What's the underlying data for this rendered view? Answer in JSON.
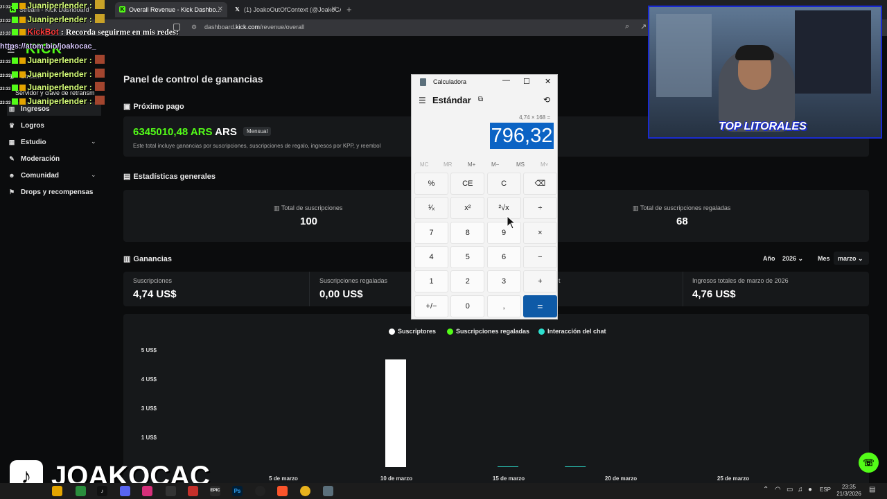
{
  "browser": {
    "tabs": [
      {
        "label": "Stream - Kick Dashboard",
        "active": false
      },
      {
        "label": "Overall Revenue - Kick Dashbo...",
        "active": true
      },
      {
        "label": "(1) JoakoOutOfContext (@JoakoCAC",
        "active": false
      }
    ],
    "url_prefix": "dashboard.",
    "url_domain": "kick.com",
    "url_path": "/revenue/overall"
  },
  "sidebar": {
    "logo": "KICK",
    "items": [
      {
        "label": "Stream",
        "icon": "stream-icon"
      },
      {
        "label": "Servidor y clave de retransm",
        "icon": "key-icon"
      },
      {
        "label": "Ingresos",
        "icon": "chart-icon",
        "active": true
      },
      {
        "label": "Logros",
        "icon": "trophy-icon"
      },
      {
        "label": "Estudio",
        "icon": "studio-icon",
        "expandable": true
      },
      {
        "label": "Moderación",
        "icon": "wrench-icon"
      },
      {
        "label": "Comunidad",
        "icon": "people-icon",
        "expandable": true
      },
      {
        "label": "Drops y recompensas",
        "icon": "gift-icon"
      }
    ]
  },
  "main": {
    "page_title": "Panel de control de ganancias",
    "next_payment": {
      "heading": "Próximo pago",
      "amount": "6345010,48 ARS",
      "currency": "ARS",
      "badge": "Mensual",
      "description": "Este total incluye ganancias por suscripciones, suscripciones de regalo, ingresos por KPP, y reembol"
    },
    "general_stats": {
      "heading": "Estadísticas generales",
      "items": [
        {
          "label": "Total de suscripciones",
          "value": "100"
        },
        {
          "label": "Total de suscripciones regaladas",
          "value": "68"
        }
      ]
    },
    "earnings": {
      "heading": "Ganancias",
      "year_label": "Año",
      "year_value": "2026",
      "month_label": "Mes",
      "month_value": "marzo",
      "items": [
        {
          "label": "Suscripciones",
          "value": "4,74 US$"
        },
        {
          "label": "Suscripciones regaladas",
          "value": "0,00 US$"
        },
        {
          "label": "t",
          "value": ""
        },
        {
          "label": "Ingresos totales de marzo de 2026",
          "value": "4,76 US$"
        }
      ]
    }
  },
  "chart_data": {
    "type": "bar",
    "series": [
      {
        "name": "Suscriptores",
        "color": "#ffffff"
      },
      {
        "name": "Suscripciones regaladas",
        "color": "#53fc18"
      },
      {
        "name": "Interacción del chat",
        "color": "#2de0d0"
      }
    ],
    "y_ticks": [
      "5 US$",
      "4 US$",
      "3 US$",
      "1 US$"
    ],
    "x_ticks": [
      "5 de marzo",
      "10 de marzo",
      "15 de marzo",
      "20 de marzo",
      "25 de marzo"
    ],
    "bars": [
      {
        "day": 10,
        "series": "Suscriptores",
        "value": 4.74
      },
      {
        "day": 15,
        "series": "Interacción del chat",
        "value": 0.01
      },
      {
        "day": 18,
        "series": "Interacción del chat",
        "value": 0.01
      }
    ],
    "ylim": [
      0,
      5
    ],
    "xlim": [
      1,
      31
    ]
  },
  "calculator": {
    "title": "Calculadora",
    "mode": "Estándar",
    "expression": "4,74 × 168 =",
    "display": "796,32",
    "memory_buttons": [
      "MC",
      "MR",
      "M+",
      "M−",
      "MS",
      "M˅"
    ],
    "rows": [
      [
        "%",
        "CE",
        "C",
        "⌫"
      ],
      [
        "¹⁄ₓ",
        "x²",
        "²√x",
        "÷"
      ],
      [
        "7",
        "8",
        "9",
        "×"
      ],
      [
        "4",
        "5",
        "6",
        "−"
      ],
      [
        "1",
        "2",
        "3",
        "+"
      ],
      [
        "+/−",
        "0",
        ",",
        "="
      ]
    ]
  },
  "chat": [
    {
      "time": "23:32",
      "user": "Juaniperlender :",
      "msg": ""
    },
    {
      "time": "23:32",
      "user": "Juaniperlender :",
      "msg": ""
    },
    {
      "time": "23:33",
      "user": "KickBot",
      "msg": ": Recorda seguirme en mis redes:"
    },
    {
      "time": "",
      "user": "https://atom.bio/joakocac_",
      "msg": ""
    },
    {
      "time": "23:33",
      "user": "Juaniperlender :",
      "msg": ""
    },
    {
      "time": "23:33",
      "user": "Juaniperlender :",
      "msg": ""
    },
    {
      "time": "23:33",
      "user": "Juaniperlender :",
      "msg": ""
    },
    {
      "time": "23:33",
      "user": "Juaniperlender :",
      "msg": ""
    }
  ],
  "overlay": {
    "webcam_banner": "TOP LITORALES",
    "tiktok_handle": "JOAKOCAC"
  },
  "taskbar": {
    "language": "ESP",
    "time": "23:35",
    "date": "21/3/2026"
  }
}
